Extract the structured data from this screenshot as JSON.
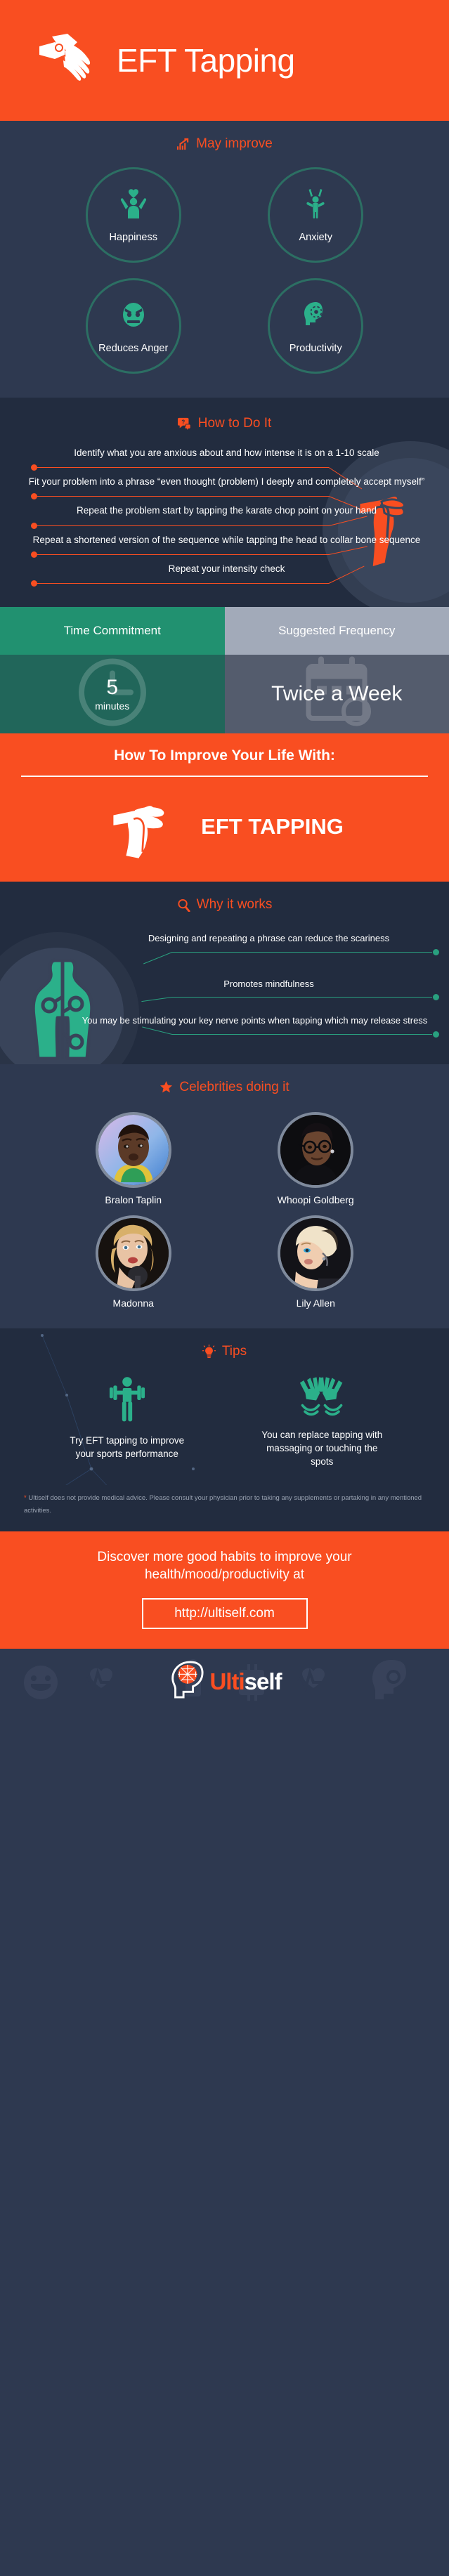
{
  "header": {
    "title": "EFT Tapping",
    "logo_icon": "tapping-hands-icon"
  },
  "may_improve": {
    "section_title": "May improve",
    "section_icon": "bar-chart-arrow-icon",
    "items": [
      {
        "label": "Happiness",
        "icon": "happy-person-heart-icon"
      },
      {
        "label": "Anxiety",
        "icon": "anxious-person-icon"
      },
      {
        "label": "Reduces Anger",
        "icon": "angry-face-icon"
      },
      {
        "label": "Productivity",
        "icon": "head-gear-icon"
      }
    ]
  },
  "how_to": {
    "section_title": "How to Do It",
    "section_icon": "question-chat-icon",
    "steps": [
      "Identify what you are anxious about and how intense it is on a 1-10 scale",
      "Fit your problem into a phrase “even thought (problem) I deeply and completely accept myself”",
      "Repeat the problem start by tapping the karate chop point on your hand",
      "Repeat a shortened version of the sequence while tapping the head to collar bone sequence",
      "Repeat your intensity check"
    ],
    "side_icon": "orange-tapping-hand-icon"
  },
  "stats_table": {
    "columns": [
      {
        "header": "Time Commitment",
        "value": "5",
        "unit": "minutes",
        "bg_icon": "clock-icon",
        "header_color": "#219170",
        "body_color": "#21665a"
      },
      {
        "header": "Suggested Frequency",
        "value": "Twice a Week",
        "unit": "",
        "bg_icon": "calendar-icon",
        "header_color": "#a2aab9",
        "body_color": "#545c6d"
      }
    ]
  },
  "cta_banner": {
    "heading": "How To Improve Your Life With:",
    "brand_word": "EFT TAPPING",
    "icon": "white-tapping-hand-icon"
  },
  "why_works": {
    "section_title": "Why it works",
    "section_icon": "magnifier-icon",
    "body_icon": "nerve-points-body-icon",
    "points": [
      "Designing and repeating a phrase can reduce the scariness",
      "Promotes mindfulness",
      "You may be stimulating your key nerve points when tapping which may release stress"
    ]
  },
  "celebrities": {
    "section_title": "Celebrities doing it",
    "section_icon": "star-icon",
    "people": [
      {
        "name": "Bralon Taplin",
        "photo": "portrait-bralon-taplin"
      },
      {
        "name": "Whoopi Goldberg",
        "photo": "portrait-whoopi-goldberg"
      },
      {
        "name": "Madonna",
        "photo": "portrait-madonna"
      },
      {
        "name": "Lily Allen",
        "photo": "portrait-lily-allen"
      }
    ]
  },
  "tips": {
    "section_title": "Tips",
    "section_icon": "lightbulb-icon",
    "items": [
      {
        "text": "Try EFT tapping to improve your sports performance",
        "icon": "weightlifter-icon"
      },
      {
        "text": "You can replace tapping with massaging or touching the spots",
        "icon": "massage-hands-icon"
      }
    ]
  },
  "disclaimer": {
    "marker": "*",
    "text": " Ultiself does not provide medical advice. Please consult your physician prior to taking any supplements or partaking in any mentioned activities."
  },
  "footer": {
    "message": "Discover more good habits to improve your health/mood/productivity at",
    "url": "http://ultiself.com"
  },
  "brand": {
    "name_prefix": "Ulti",
    "name_suffix": "self",
    "logo_icon": "brain-head-icon"
  },
  "colors": {
    "orange": "#f94e21",
    "dark_navy": "#222c3f",
    "navy": "#2e3950",
    "teal": "#29a07f",
    "teal_dark": "#2c6f63",
    "grey_text": "#9aa3b2"
  }
}
